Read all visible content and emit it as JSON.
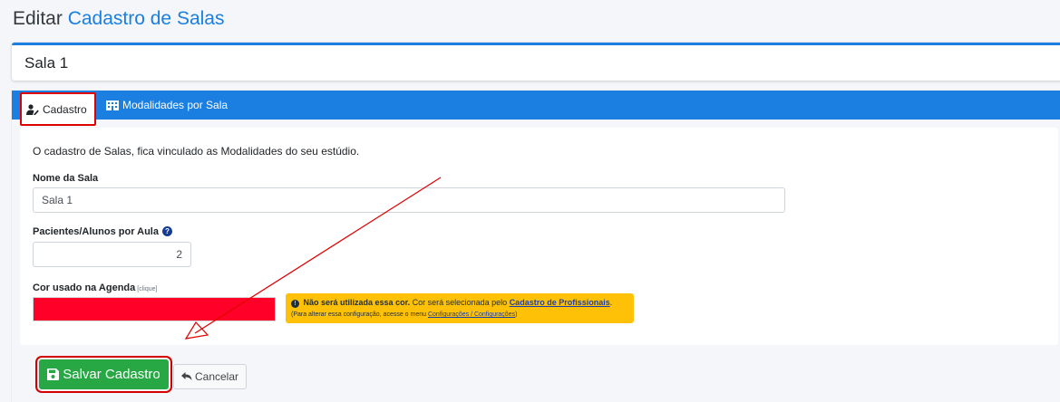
{
  "header": {
    "prefix": "Editar",
    "accent": "Cadastro de Salas"
  },
  "record": {
    "title": "Sala 1"
  },
  "tabs": [
    {
      "label": "Cadastro",
      "icon": "user-edit-icon",
      "active": true
    },
    {
      "label": "Modalidades por Sala",
      "icon": "building-icon",
      "active": false
    }
  ],
  "form": {
    "description": "O cadastro de Salas, fica vinculado as Modalidades do seu estúdio.",
    "room_name": {
      "label": "Nome da Sala",
      "value": "Sala 1"
    },
    "students_per_class": {
      "label": "Pacientes/Alunos por Aula",
      "help_icon": "question-circle-icon",
      "value": "2"
    },
    "agenda_color": {
      "label": "Cor usado na Agenda",
      "hint": "[clique]",
      "value": "#ff0028"
    },
    "alert": {
      "icon": "exclamation-circle-icon",
      "bold": "Não será utilizada essa cor.",
      "text": "Cor será selecionada pelo",
      "link": "Cadastro de Profissionais",
      "end": ".",
      "note": "(Para alterar essa configuração, acesse o menu",
      "note_link": "Configurações / Configurações",
      "note_end": ")"
    }
  },
  "actions": {
    "save_label": "Salvar Cadastro",
    "save_icon": "save-icon",
    "cancel_label": "Cancelar",
    "cancel_icon": "undo-icon"
  },
  "colors": {
    "primary": "#1a7fe0",
    "success": "#28a745",
    "warning": "#ffc107",
    "annotation": "#e00000"
  }
}
